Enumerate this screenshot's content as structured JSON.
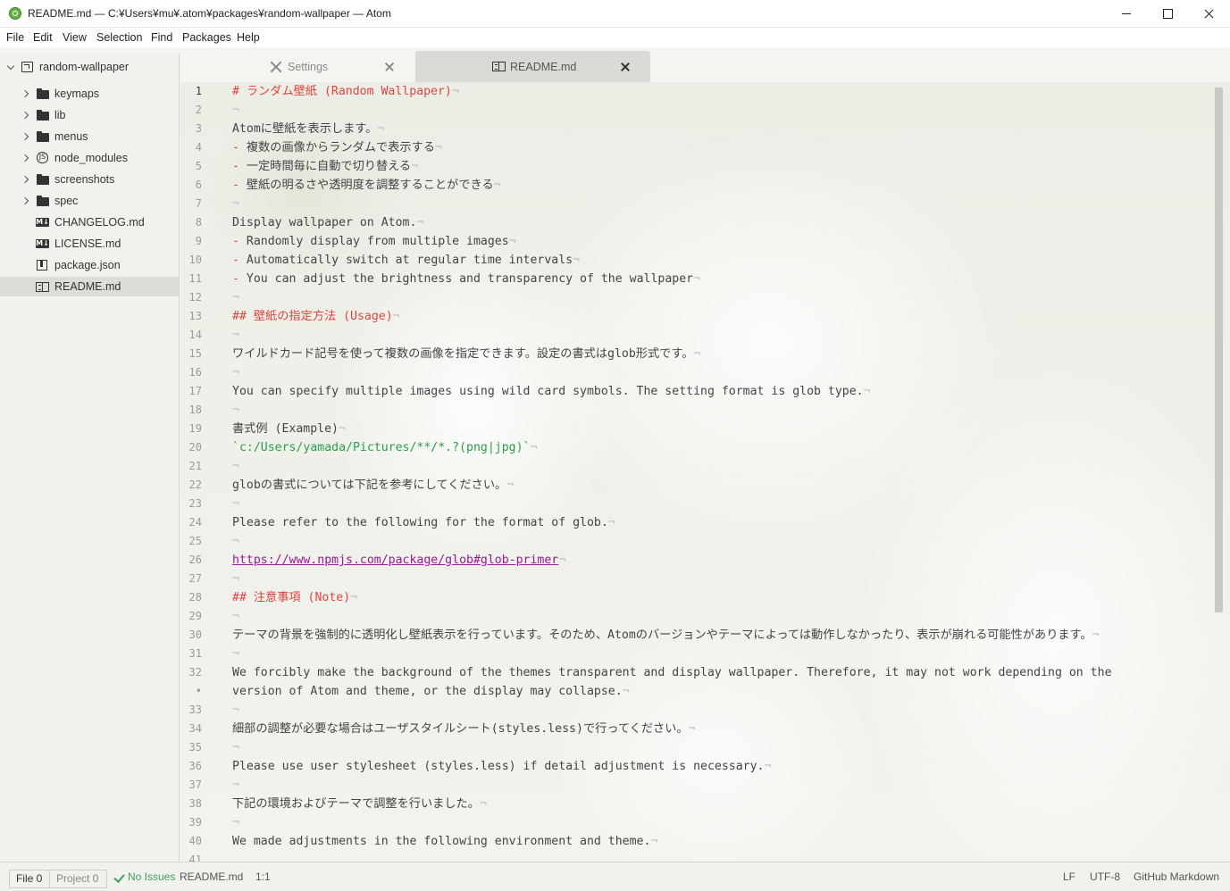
{
  "window": {
    "title": "README.md — C:¥Users¥mu¥.atom¥packages¥random-wallpaper — Atom"
  },
  "menu": [
    "File",
    "Edit",
    "View",
    "Selection",
    "Find",
    "Packages",
    "Help"
  ],
  "tree": {
    "root": "random-wallpaper",
    "items": [
      {
        "label": "keymaps",
        "icon": "folder-icon",
        "type": "folder"
      },
      {
        "label": "lib",
        "icon": "folder-icon",
        "type": "folder"
      },
      {
        "label": "menus",
        "icon": "folder-icon",
        "type": "folder"
      },
      {
        "label": "node_modules",
        "icon": "node-modules-icon",
        "type": "folder"
      },
      {
        "label": "screenshots",
        "icon": "folder-icon",
        "type": "folder"
      },
      {
        "label": "spec",
        "icon": "folder-icon",
        "type": "folder"
      },
      {
        "label": "CHANGELOG.md",
        "icon": "markdown-icon",
        "type": "file"
      },
      {
        "label": "LICENSE.md",
        "icon": "markdown-icon",
        "type": "file"
      },
      {
        "label": "package.json",
        "icon": "package-icon",
        "type": "file"
      },
      {
        "label": "README.md",
        "icon": "book-icon",
        "type": "file",
        "selected": true
      }
    ]
  },
  "tabs": [
    {
      "label": "Settings",
      "icon": "tools-icon",
      "active": false
    },
    {
      "label": "README.md",
      "icon": "book-icon",
      "active": true
    }
  ],
  "editor": {
    "eol_char": "¬",
    "lines": [
      {
        "n": "1",
        "text": "# ランダム壁紙 (Random Wallpaper)",
        "style": "heading"
      },
      {
        "n": "2",
        "text": "",
        "style": "plain"
      },
      {
        "n": "3",
        "text": "Atomに壁紙を表示します。",
        "style": "plain"
      },
      {
        "n": "4",
        "prefix": "- ",
        "text": "複数の画像からランダムで表示する",
        "style": "list"
      },
      {
        "n": "5",
        "prefix": "- ",
        "text": "一定時間毎に自動で切り替える",
        "style": "list"
      },
      {
        "n": "6",
        "prefix": "- ",
        "text": "壁紙の明るさや透明度を調整することができる",
        "style": "list"
      },
      {
        "n": "7",
        "text": "",
        "style": "plain"
      },
      {
        "n": "8",
        "text": "Display wallpaper on Atom.",
        "style": "plain"
      },
      {
        "n": "9",
        "prefix": "- ",
        "text": "Randomly display from multiple images",
        "style": "list"
      },
      {
        "n": "10",
        "prefix": "- ",
        "text": "Automatically switch at regular time intervals",
        "style": "list"
      },
      {
        "n": "11",
        "prefix": "- ",
        "text": "You can adjust the brightness and transparency of the wallpaper",
        "style": "list"
      },
      {
        "n": "12",
        "text": "",
        "style": "plain"
      },
      {
        "n": "13",
        "text": "## 壁紙の指定方法 (Usage)",
        "style": "heading"
      },
      {
        "n": "14",
        "text": "",
        "style": "plain"
      },
      {
        "n": "15",
        "text": "ワイルドカード記号を使って複数の画像を指定できます。設定の書式はglob形式です。",
        "style": "plain"
      },
      {
        "n": "16",
        "text": "",
        "style": "plain"
      },
      {
        "n": "17",
        "text": "You can specify multiple images using wild card symbols. The setting format is glob type.",
        "style": "plain"
      },
      {
        "n": "18",
        "text": "",
        "style": "plain"
      },
      {
        "n": "19",
        "text": "書式例 (Example)",
        "style": "plain"
      },
      {
        "n": "20",
        "text": "`c:/Users/yamada/Pictures/**/*.?(png|jpg)`",
        "style": "code"
      },
      {
        "n": "21",
        "text": "",
        "style": "plain"
      },
      {
        "n": "22",
        "text": "globの書式については下記を参考にしてください。",
        "style": "plain"
      },
      {
        "n": "23",
        "text": "",
        "style": "plain"
      },
      {
        "n": "24",
        "text": "Please refer to the following for the format of glob.",
        "style": "plain"
      },
      {
        "n": "25",
        "text": "",
        "style": "plain"
      },
      {
        "n": "26",
        "text": "https://www.npmjs.com/package/glob#glob-primer",
        "style": "link"
      },
      {
        "n": "27",
        "text": "",
        "style": "plain"
      },
      {
        "n": "28",
        "text": "## 注意事項 (Note)",
        "style": "heading"
      },
      {
        "n": "29",
        "text": "",
        "style": "plain"
      },
      {
        "n": "30",
        "text": "テーマの背景を強制的に透明化し壁紙表示を行っています。そのため、Atomのバージョンやテーマによっては動作しなかったり、表示が崩れる可能性があります。",
        "style": "plain"
      },
      {
        "n": "31",
        "text": "",
        "style": "plain"
      },
      {
        "n": "32",
        "text": "We forcibly make the background of the themes transparent and display wallpaper. Therefore, it may not work depending on the",
        "style": "plain",
        "noeol": true
      },
      {
        "n": "•",
        "text": "version of Atom and theme, or the display may collapse.",
        "style": "plain"
      },
      {
        "n": "33",
        "text": "",
        "style": "plain"
      },
      {
        "n": "34",
        "text": "細部の調整が必要な場合はユーザスタイルシート(styles.less)で行ってください。",
        "style": "plain"
      },
      {
        "n": "35",
        "text": "",
        "style": "plain"
      },
      {
        "n": "36",
        "text": "Please use user stylesheet (styles.less) if detail adjustment is necessary.",
        "style": "plain"
      },
      {
        "n": "37",
        "text": "",
        "style": "plain"
      },
      {
        "n": "38",
        "text": "下記の環境およびテーマで調整を行いました。",
        "style": "plain"
      },
      {
        "n": "39",
        "text": "",
        "style": "plain"
      },
      {
        "n": "40",
        "text": "We made adjustments in the following environment and theme.",
        "style": "plain"
      },
      {
        "n": "41",
        "text": "",
        "style": "plain"
      }
    ]
  },
  "status": {
    "file_count": "File 0",
    "project_count": "Project 0",
    "issues": "No Issues",
    "filename": "README.md",
    "cursor": "1:1",
    "line_ending": "LF",
    "encoding": "UTF-8",
    "grammar": "GitHub Markdown"
  },
  "colors": {
    "heading": "#e0443e",
    "code": "#2aa147",
    "link": "#a0149e",
    "ok": "#3ea15a"
  }
}
